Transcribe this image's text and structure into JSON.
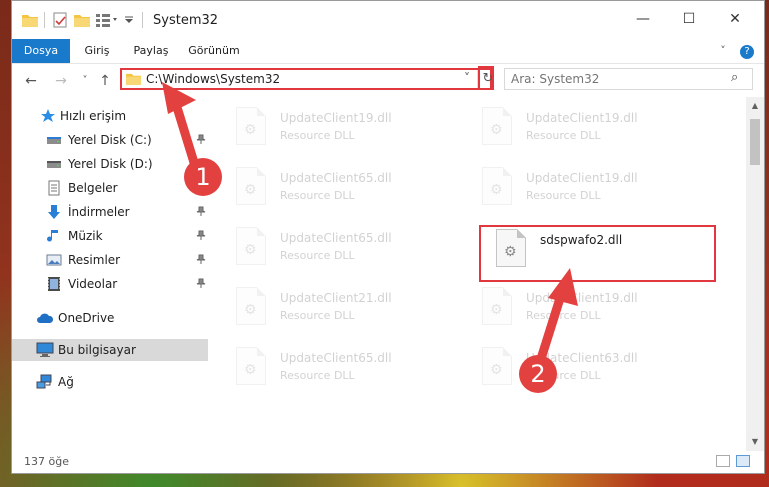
{
  "window": {
    "title": "System32",
    "minimize_glyph": "—",
    "maximize_glyph": "☐",
    "close_glyph": "✕"
  },
  "ribbon": {
    "tabs": [
      {
        "label": "Dosya"
      },
      {
        "label": "Giriş"
      },
      {
        "label": "Paylaş"
      },
      {
        "label": "Görünüm"
      }
    ],
    "collapse_glyph": "˅",
    "help_glyph": "?"
  },
  "navigation": {
    "back_glyph": "←",
    "forward_glyph": "→",
    "recent_glyph": "˅",
    "up_glyph": "↑",
    "address": "C:\\Windows\\System32",
    "address_dropdown_glyph": "˅",
    "refresh_glyph": "↻",
    "search_placeholder": "Ara: System32",
    "search_glyph": "⌕"
  },
  "sidebar": {
    "pin_glyph": "📌",
    "items": [
      {
        "label": "Hızlı erişim",
        "icon": "star-icon",
        "pinned": false
      },
      {
        "label": "Yerel Disk (C:)",
        "icon": "drive-icon",
        "pinned": true
      },
      {
        "label": "Yerel Disk (D:)",
        "icon": "drive-icon",
        "pinned": false
      },
      {
        "label": "Belgeler",
        "icon": "documents-icon",
        "pinned": true
      },
      {
        "label": "İndirmeler",
        "icon": "downloads-icon",
        "pinned": true
      },
      {
        "label": "Müzik",
        "icon": "music-icon",
        "pinned": true
      },
      {
        "label": "Resimler",
        "icon": "pictures-icon",
        "pinned": true
      },
      {
        "label": "Videolar",
        "icon": "videos-icon",
        "pinned": true
      },
      {
        "label": "OneDrive",
        "icon": "cloud-icon",
        "pinned": false
      },
      {
        "label": "Bu bilgisayar",
        "icon": "computer-icon",
        "pinned": false,
        "selected": true
      },
      {
        "label": "Ağ",
        "icon": "network-icon",
        "pinned": false
      }
    ]
  },
  "files": [
    {
      "name": "UpdateClient19.dll",
      "type": "Resource DLL"
    },
    {
      "name": "UpdateClient19.dll",
      "type": "Resource DLL"
    },
    {
      "name": "UpdateClient65.dll",
      "type": "Resource DLL"
    },
    {
      "name": "UpdateClient19.dll",
      "type": "Resource DLL"
    },
    {
      "name": "UpdateClient65.dll",
      "type": "Resource DLL"
    },
    {
      "name": "sdspwafo2.dll",
      "type": "",
      "highlighted": true
    },
    {
      "name": "UpdateClient21.dll",
      "type": "Resource DLL"
    },
    {
      "name": "UpdateClient19.dll",
      "type": "Resource DLL"
    },
    {
      "name": "UpdateClient65.dll",
      "type": "Resource DLL"
    },
    {
      "name": "UpdateClient63.dll",
      "type": "Resource DLL"
    }
  ],
  "status": {
    "item_count": "137 öğe"
  },
  "annotations": {
    "step1": "1",
    "step2": "2",
    "color": "#e34040"
  }
}
